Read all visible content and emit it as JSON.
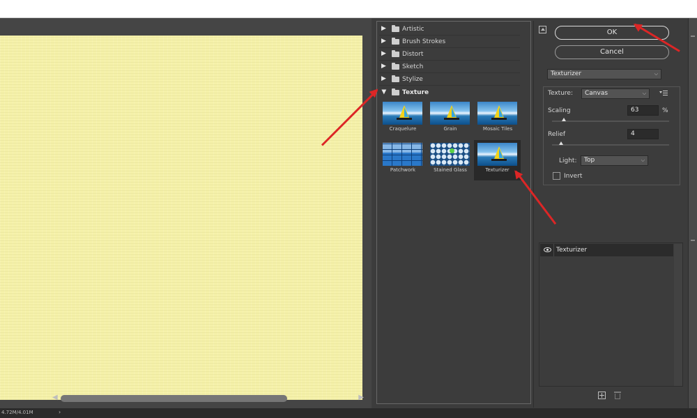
{
  "filter_gallery": {
    "folders": [
      {
        "label": "Artistic",
        "expanded": false
      },
      {
        "label": "Brush Strokes",
        "expanded": false
      },
      {
        "label": "Distort",
        "expanded": false
      },
      {
        "label": "Sketch",
        "expanded": false
      },
      {
        "label": "Stylize",
        "expanded": false
      },
      {
        "label": "Texture",
        "expanded": true
      }
    ],
    "texture_filters": [
      {
        "label": "Craquelure",
        "selected": false
      },
      {
        "label": "Grain",
        "selected": false
      },
      {
        "label": "Mosaic Tiles",
        "selected": false
      },
      {
        "label": "Patchwork",
        "selected": false
      },
      {
        "label": "Stained Glass",
        "selected": false
      },
      {
        "label": "Texturizer",
        "selected": true
      }
    ]
  },
  "dialog": {
    "ok_label": "OK",
    "cancel_label": "Cancel",
    "filter_select": "Texturizer",
    "settings": {
      "texture_label": "Texture:",
      "texture_value": "Canvas",
      "scaling_label": "Scaling",
      "scaling_value": "63",
      "scaling_unit": "%",
      "scaling_fraction": 0.1,
      "relief_label": "Relief",
      "relief_value": "4",
      "relief_fraction": 0.08,
      "light_label": "Light:",
      "light_value": "Top",
      "invert_label": "Invert",
      "invert_checked": false
    },
    "effect_layers": [
      {
        "name": "Texturizer",
        "visible": true
      }
    ]
  },
  "canvas": {
    "preview_color": "#f5f1a9"
  },
  "status": {
    "doc_size": "4.72M/4.01M",
    "chevron": "›"
  },
  "annotation_color": "#dc2626"
}
